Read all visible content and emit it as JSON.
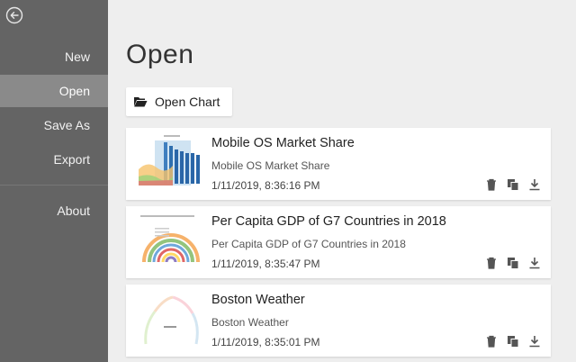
{
  "sidebar": {
    "back_icon": "arrow-left-circle-icon",
    "items": [
      {
        "label": "New"
      },
      {
        "label": "Open"
      },
      {
        "label": "Save As"
      },
      {
        "label": "Export"
      },
      {
        "label": "About"
      }
    ],
    "active": "Open"
  },
  "main": {
    "title": "Open",
    "open_button": {
      "label": "Open Chart",
      "icon": "folder-open-icon"
    },
    "charts": [
      {
        "title": "Mobile OS Market Share",
        "subtitle": "Mobile OS Market Share",
        "date": "1/11/2019, 8:36:16 PM"
      },
      {
        "title": "Per Capita GDP of G7 Countries in 2018",
        "subtitle": "Per Capita GDP of G7 Countries in 2018",
        "date": "1/11/2019, 8:35:47 PM"
      },
      {
        "title": "Boston Weather",
        "subtitle": "Boston Weather",
        "date": "1/11/2019, 8:35:01 PM"
      }
    ],
    "card_actions": [
      "trash-icon",
      "copy-icon",
      "download-icon"
    ]
  },
  "colors": {
    "sidebar_bg": "#646464",
    "sidebar_active": "#8a8a8a",
    "main_bg": "#eeeeee"
  }
}
